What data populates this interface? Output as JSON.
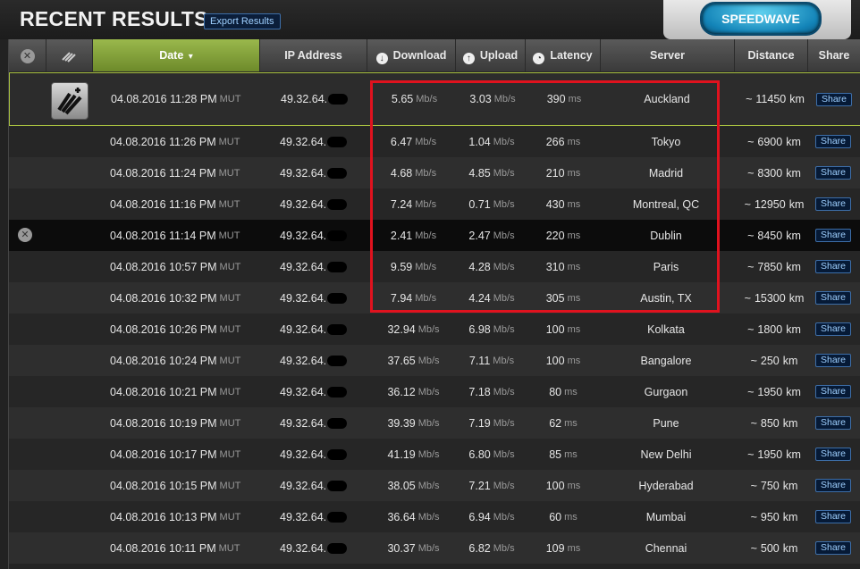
{
  "page": {
    "title": "RECENT RESULTS",
    "export_label": "Export Results",
    "speedwave_label": "SPEEDWAVE"
  },
  "header": {
    "close_glyph": "✕",
    "date": "Date",
    "sort_glyph": "▾",
    "ip": "IP Address",
    "download": "Download",
    "upload": "Upload",
    "latency": "Latency",
    "server": "Server",
    "distance": "Distance",
    "share": "Share"
  },
  "row_close_glyph": "✕",
  "units": {
    "speed": "Mb/s",
    "latency": "ms",
    "timezone": "MUT",
    "distance_prefix": "~",
    "distance_unit": "km"
  },
  "rows": [
    {
      "date": "04.08.2016 11:28 PM",
      "ip": "49.32.64.",
      "dl": "5.65",
      "ul": "3.03",
      "lat": "390",
      "server": "Auckland",
      "dist": "11450",
      "share": "Share"
    },
    {
      "date": "04.08.2016 11:26 PM",
      "ip": "49.32.64.",
      "dl": "6.47",
      "ul": "1.04",
      "lat": "266",
      "server": "Tokyo",
      "dist": "6900",
      "share": "Share"
    },
    {
      "date": "04.08.2016 11:24 PM",
      "ip": "49.32.64.",
      "dl": "4.68",
      "ul": "4.85",
      "lat": "210",
      "server": "Madrid",
      "dist": "8300",
      "share": "Share"
    },
    {
      "date": "04.08.2016 11:16 PM",
      "ip": "49.32.64.",
      "dl": "7.24",
      "ul": "0.71",
      "lat": "430",
      "server": "Montreal, QC",
      "dist": "12950",
      "share": "Share"
    },
    {
      "date": "04.08.2016 11:14 PM",
      "ip": "49.32.64.",
      "dl": "2.41",
      "ul": "2.47",
      "lat": "220",
      "server": "Dublin",
      "dist": "8450",
      "share": "Share"
    },
    {
      "date": "04.08.2016 10:57 PM",
      "ip": "49.32.64.",
      "dl": "9.59",
      "ul": "4.28",
      "lat": "310",
      "server": "Paris",
      "dist": "7850",
      "share": "Share"
    },
    {
      "date": "04.08.2016 10:32 PM",
      "ip": "49.32.64.",
      "dl": "7.94",
      "ul": "4.24",
      "lat": "305",
      "server": "Austin, TX",
      "dist": "15300",
      "share": "Share"
    },
    {
      "date": "04.08.2016 10:26 PM",
      "ip": "49.32.64.",
      "dl": "32.94",
      "ul": "6.98",
      "lat": "100",
      "server": "Kolkata",
      "dist": "1800",
      "share": "Share"
    },
    {
      "date": "04.08.2016 10:24 PM",
      "ip": "49.32.64.",
      "dl": "37.65",
      "ul": "7.11",
      "lat": "100",
      "server": "Bangalore",
      "dist": "250",
      "share": "Share"
    },
    {
      "date": "04.08.2016 10:21 PM",
      "ip": "49.32.64.",
      "dl": "36.12",
      "ul": "7.18",
      "lat": "80",
      "server": "Gurgaon",
      "dist": "1950",
      "share": "Share"
    },
    {
      "date": "04.08.2016 10:19 PM",
      "ip": "49.32.64.",
      "dl": "39.39",
      "ul": "7.19",
      "lat": "62",
      "server": "Pune",
      "dist": "850",
      "share": "Share"
    },
    {
      "date": "04.08.2016 10:17 PM",
      "ip": "49.32.64.",
      "dl": "41.19",
      "ul": "6.80",
      "lat": "85",
      "server": "New Delhi",
      "dist": "1950",
      "share": "Share"
    },
    {
      "date": "04.08.2016 10:15 PM",
      "ip": "49.32.64.",
      "dl": "38.05",
      "ul": "7.21",
      "lat": "100",
      "server": "Hyderabad",
      "dist": "750",
      "share": "Share"
    },
    {
      "date": "04.08.2016 10:13 PM",
      "ip": "49.32.64.",
      "dl": "36.64",
      "ul": "6.94",
      "lat": "60",
      "server": "Mumbai",
      "dist": "950",
      "share": "Share"
    },
    {
      "date": "04.08.2016 10:11 PM",
      "ip": "49.32.64.",
      "dl": "30.37",
      "ul": "6.82",
      "lat": "109",
      "server": "Chennai",
      "dist": "500",
      "share": "Share"
    }
  ],
  "colors": {
    "accent_green": "#9ab84c",
    "highlight_red": "#e0121e",
    "share_blue": "#9fd0ff"
  }
}
